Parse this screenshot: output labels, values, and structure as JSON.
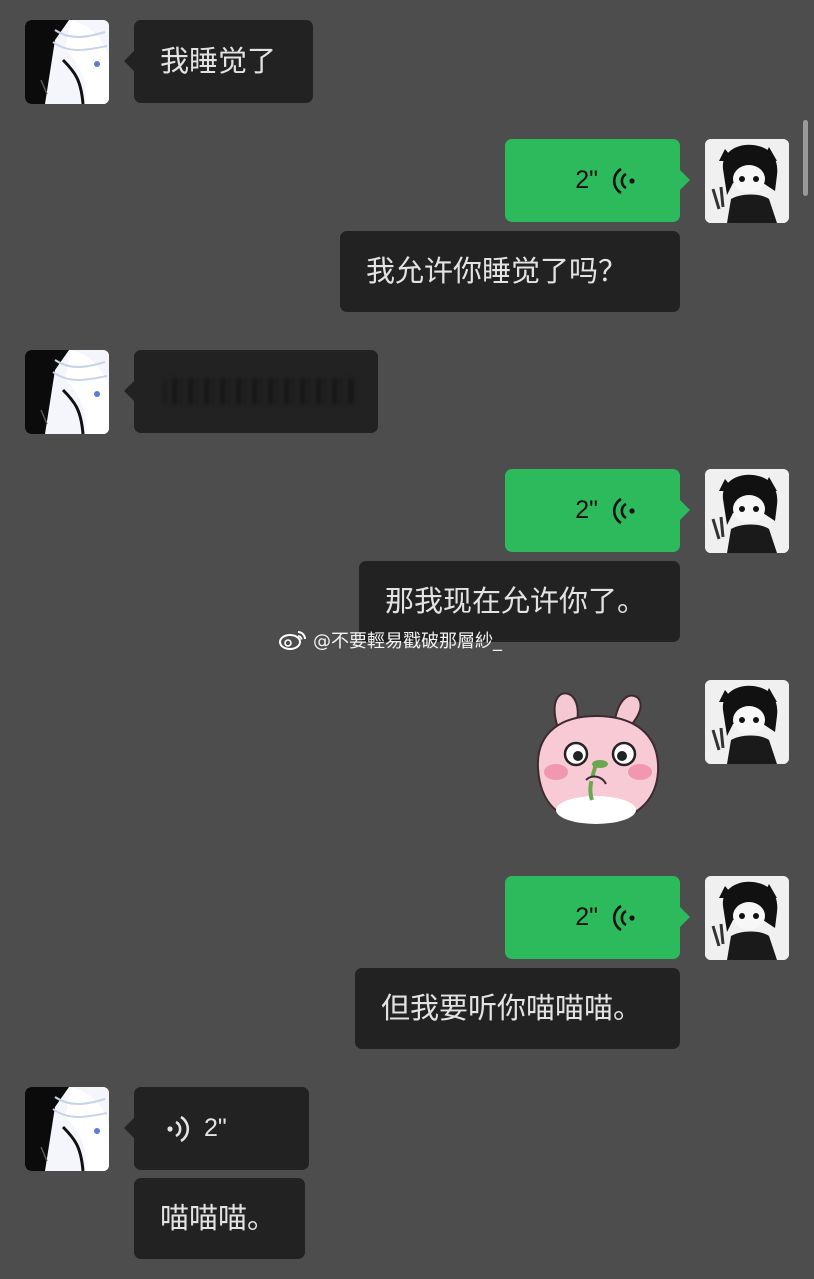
{
  "messages": [
    {
      "side": "left",
      "type": "text",
      "text": "我睡觉了"
    },
    {
      "side": "right",
      "type": "voice",
      "duration": "2\""
    },
    {
      "side": "right",
      "type": "text",
      "text": "我允许你睡觉了吗？"
    },
    {
      "side": "left",
      "type": "text",
      "text": "",
      "note": "blurred"
    },
    {
      "side": "right",
      "type": "voice",
      "duration": "2\""
    },
    {
      "side": "right",
      "type": "text",
      "text": "那我现在允许你了。"
    },
    {
      "side": "right",
      "type": "sticker",
      "sticker": "pink-bunny-sticker"
    },
    {
      "side": "right",
      "type": "voice",
      "duration": "2\""
    },
    {
      "side": "right",
      "type": "text",
      "text": "但我要听你喵喵喵。"
    },
    {
      "side": "left",
      "type": "voice",
      "duration": "2\""
    },
    {
      "side": "left",
      "type": "text",
      "text": "喵喵喵。"
    }
  ],
  "watermark": "@不要輕易戳破那層紗_",
  "colors": {
    "background": "#4d4d4d",
    "bubble_dark": "#222222",
    "bubble_green": "#2dba5d",
    "text_light": "#e3e3e3"
  },
  "icons": {
    "voice": "voice-wave-icon",
    "watermark": "weibo-icon"
  }
}
